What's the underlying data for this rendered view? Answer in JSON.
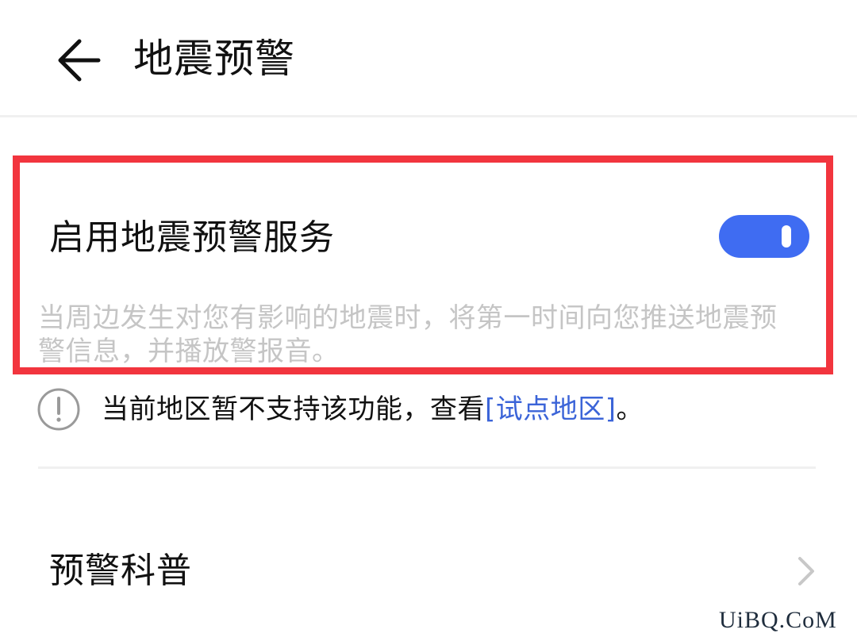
{
  "header": {
    "title": "地震预警",
    "back_icon": "arrow-left-icon"
  },
  "service": {
    "label": "启用地震预警服务",
    "enabled": true,
    "toggle_color": "#3f6cf2",
    "description": "当周边发生对您有影响的地震时，将第一时间向您推送地震预警信息，并播放警报音。"
  },
  "notice": {
    "icon": "info-exclamation-icon",
    "text_before": "当前地区暂不支持该功能，查看",
    "link_text": "[试点地区]",
    "text_after": "。",
    "link_color": "#3b64d8"
  },
  "list": {
    "items": [
      {
        "label": "预警科普",
        "icon": "chevron-right-icon"
      }
    ]
  },
  "highlight": {
    "color": "#f2353e"
  },
  "watermark": "UiBQ.CoM"
}
